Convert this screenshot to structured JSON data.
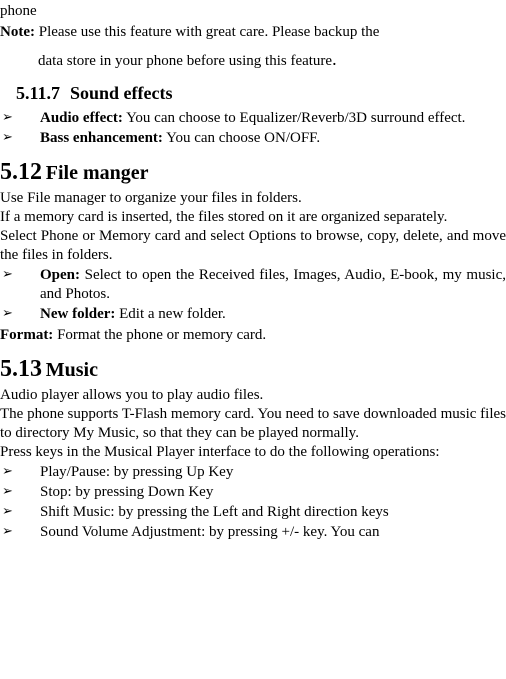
{
  "top": {
    "phone": "phone",
    "note_label": "Note:",
    "note_text_line1": " Please use this feature with great care. Please backup the",
    "note_text_line2": "data store in your phone before using this feature",
    "dot": "."
  },
  "sec_5_11_7": {
    "num": "5.11.7",
    "title": "Sound effects",
    "items": [
      {
        "label": "Audio effect:",
        "text": " You can choose to Equalizer/Reverb/3D surround effect."
      },
      {
        "label": "Bass enhancement:",
        "text": " You can choose ON/OFF."
      }
    ]
  },
  "sec_5_12": {
    "num": "5.12",
    "title": "File manger",
    "p1": "Use File manager to organize your files in folders.",
    "p2": "If a memory card is inserted, the files stored on it are organized separately.",
    "p3": "Select Phone or Memory card and select Options to browse, copy, delete, and move the files in folders.",
    "items": [
      {
        "label": "Open:",
        "text": " Select to open the Received files, Images, Audio, E-book, my music, and Photos."
      },
      {
        "label": "New folder:",
        "text": " Edit a new folder."
      }
    ],
    "format_label": "Format:",
    "format_text": " Format the phone or memory card."
  },
  "sec_5_13": {
    "num": "5.13",
    "title": "Music",
    "p1": "Audio player allows you to play audio files.",
    "p2": "The phone supports T-Flash memory card. You need to save downloaded music files to directory My Music, so that they can be played normally.",
    "p3": "Press keys in the Musical Player interface to do the following operations:",
    "items": [
      {
        "text": "Play/Pause: by pressing Up Key"
      },
      {
        "text": "Stop: by pressing Down Key"
      },
      {
        "text": "Shift Music: by pressing the Left and Right direction keys"
      },
      {
        "text": "Sound Volume Adjustment: by pressing +/- key. You can"
      }
    ]
  }
}
